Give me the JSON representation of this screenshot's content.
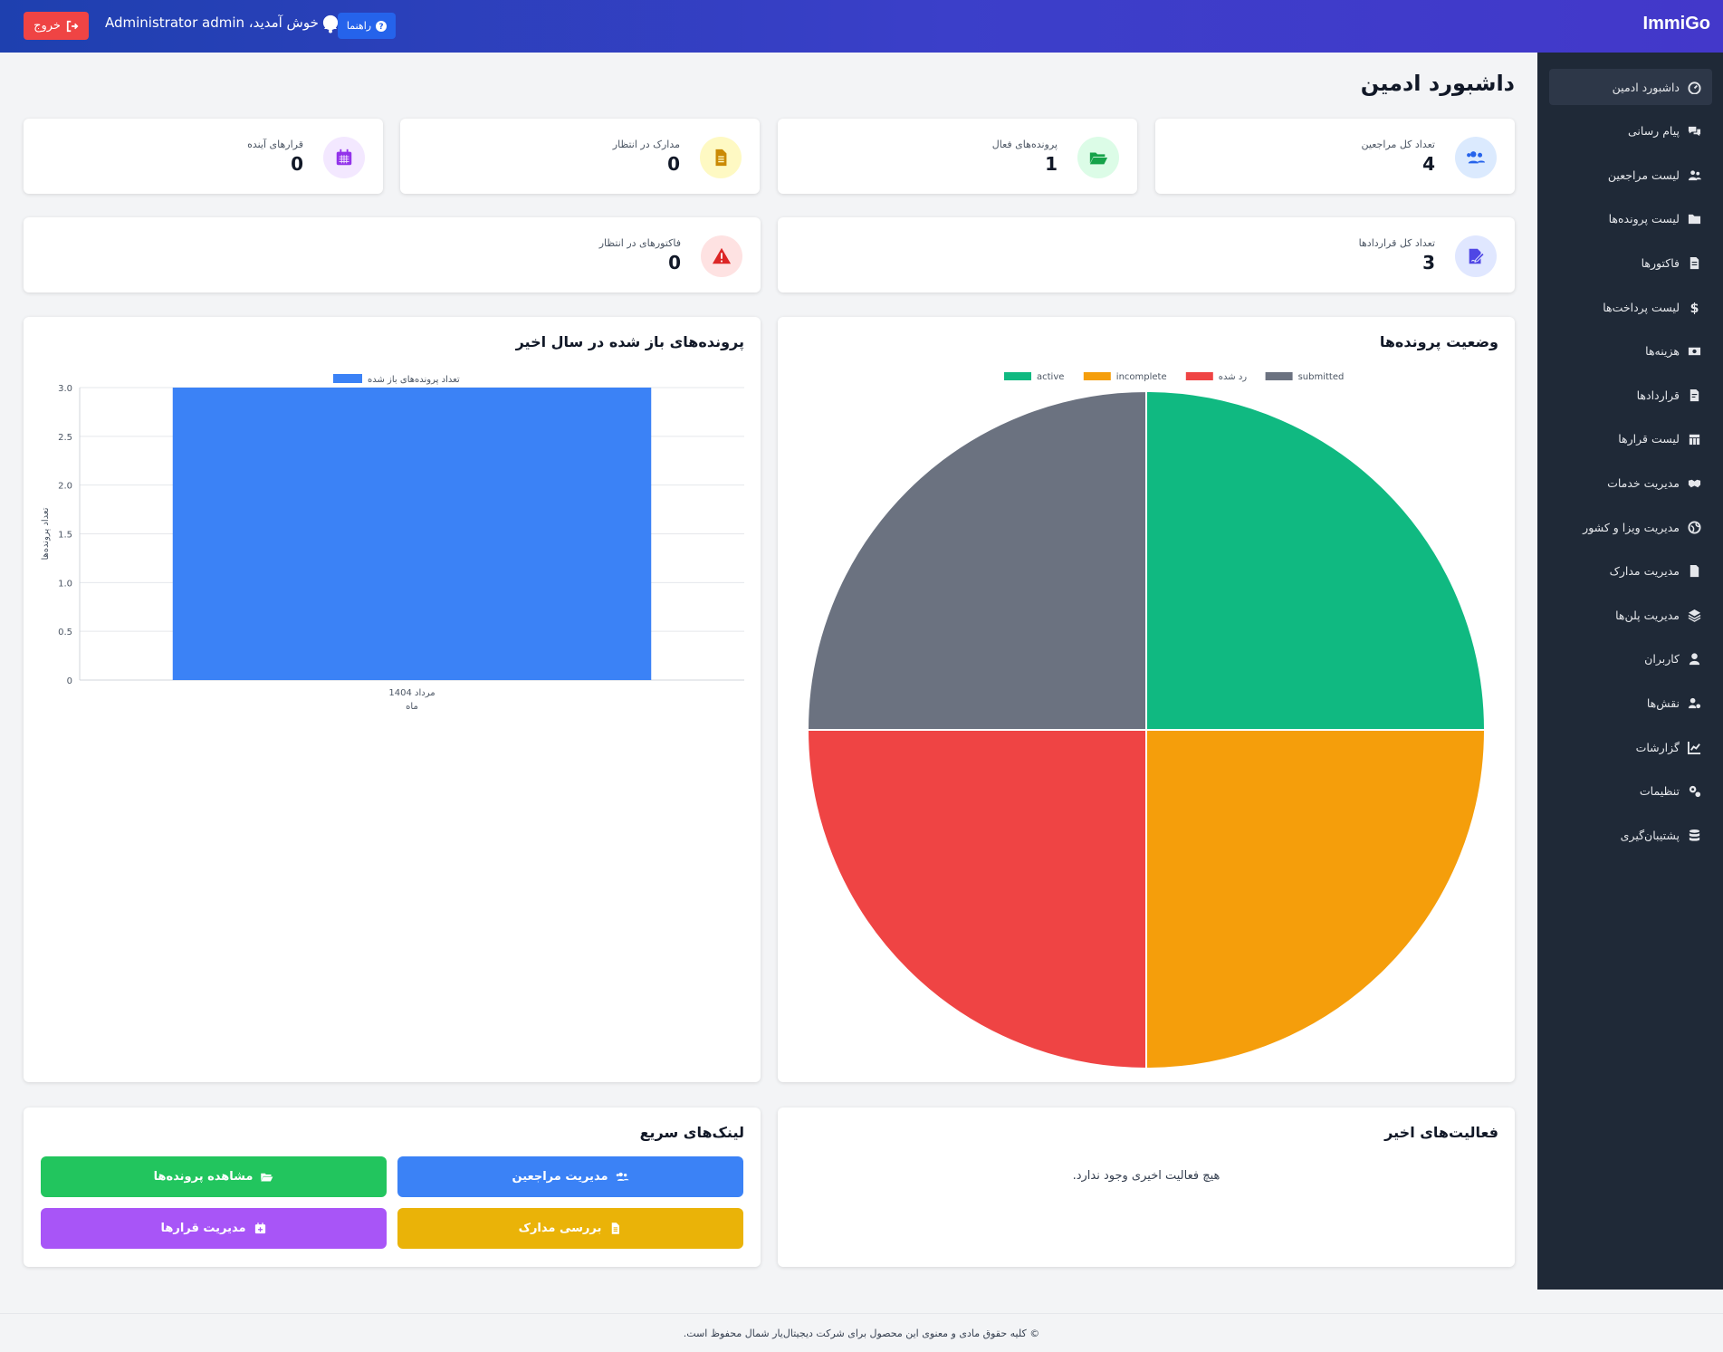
{
  "header": {
    "brand": "ImmiGo",
    "logout_label": "خروج",
    "welcome_text": "خوش آمدید، Administrator admin",
    "help_label": "راهنما"
  },
  "sidebar": {
    "items": [
      {
        "label": "داشبورد ادمین",
        "icon": "dashboard-icon"
      },
      {
        "label": "پیام رسانی",
        "icon": "chat-icon"
      },
      {
        "label": "لیست مراجعین",
        "icon": "users-icon"
      },
      {
        "label": "لیست پرونده‌ها",
        "icon": "folder-icon"
      },
      {
        "label": "فاکتورها",
        "icon": "invoice-icon"
      },
      {
        "label": "لیست پرداخت‌ها",
        "icon": "dollar-icon"
      },
      {
        "label": "هزینه‌ها",
        "icon": "money-icon"
      },
      {
        "label": "قراردادها",
        "icon": "contract-icon"
      },
      {
        "label": "لیست قرارها",
        "icon": "calendar-icon"
      },
      {
        "label": "مدیریت خدمات",
        "icon": "handshake-icon"
      },
      {
        "label": "مدیریت ویزا و کشور",
        "icon": "globe-icon"
      },
      {
        "label": "مدیریت مدارک",
        "icon": "document-icon"
      },
      {
        "label": "مدیریت پلن‌ها",
        "icon": "layers-icon"
      },
      {
        "label": "کاربران",
        "icon": "user-icon"
      },
      {
        "label": "نقش‌ها",
        "icon": "user-gear-icon"
      },
      {
        "label": "گزارشات",
        "icon": "line-chart-icon"
      },
      {
        "label": "تنظیمات",
        "icon": "cogs-icon"
      },
      {
        "label": "پشتیبان‌گیری",
        "icon": "database-icon"
      }
    ]
  },
  "page": {
    "title": "داشبورد ادمین"
  },
  "stats": [
    {
      "label": "تعداد کل مراجعین",
      "value": "4",
      "icon": "users-icon",
      "color": "#2563eb",
      "bg": "#dbeafe"
    },
    {
      "label": "پرونده‌های فعال",
      "value": "1",
      "icon": "folder-open-icon",
      "color": "#16a34a",
      "bg": "#dcfce7"
    },
    {
      "label": "مدارک در انتظار",
      "value": "0",
      "icon": "file-icon",
      "color": "#ca8a04",
      "bg": "#fef9c3"
    },
    {
      "label": "قرارهای آینده",
      "value": "0",
      "icon": "calendar-icon",
      "color": "#9333ea",
      "bg": "#f3e8ff"
    },
    {
      "label": "تعداد کل قراردادها",
      "value": "3",
      "icon": "signature-icon",
      "color": "#4f46e5",
      "bg": "#e0e7ff"
    },
    {
      "label": "فاکتورهای در انتظار",
      "value": "0",
      "icon": "warning-icon",
      "color": "#dc2626",
      "bg": "#fee2e2"
    }
  ],
  "status_panel": {
    "title": "وضعیت پرونده‌ها"
  },
  "opened_panel": {
    "title": "پرونده‌های باز شده در سال اخیر"
  },
  "chart_data": [
    {
      "type": "pie",
      "title": "وضعیت پرونده‌ها",
      "categories": [
        "active",
        "incomplete",
        "رد شده",
        "submitted"
      ],
      "values": [
        1,
        1,
        1,
        1
      ],
      "colors": [
        "#10b981",
        "#f59e0b",
        "#ef4444",
        "#6b7280"
      ],
      "legend": "top"
    },
    {
      "type": "bar",
      "title": "پرونده‌های باز شده در سال اخیر",
      "categories": [
        "مرداد 1404"
      ],
      "series": [
        {
          "name": "تعداد پرونده‌های باز شده",
          "values": [
            3
          ],
          "color": "#3b82f6"
        }
      ],
      "xlabel": "ماه",
      "ylabel": "تعداد پرونده‌ها",
      "ylim": [
        0,
        3.0
      ],
      "yticks": [
        "0",
        "0.5",
        "1.0",
        "1.5",
        "2.0",
        "2.5",
        "3.0"
      ],
      "grid": true,
      "legend": "top"
    }
  ],
  "activity": {
    "title": "فعالیت‌های اخیر",
    "empty_text": "هیچ فعالیت اخیری وجود ندارد."
  },
  "quick_links": {
    "title": "لینک‌های سریع",
    "buttons": [
      {
        "label": "مدیریت مراجعین",
        "icon": "users-icon",
        "color": "#3b82f6"
      },
      {
        "label": "مشاهده پرونده‌ها",
        "icon": "folder-open-icon",
        "color": "#22c55e"
      },
      {
        "label": "بررسی مدارک",
        "icon": "file-icon",
        "color": "#eab308"
      },
      {
        "label": "مدیریت قرارها",
        "icon": "calendar-plus-icon",
        "color": "#a855f7"
      }
    ]
  },
  "footer": {
    "text": "© کلیه حقوق مادی و معنوی این محصول برای شرکت دیجیتال‌یار شمال محفوظ است."
  }
}
